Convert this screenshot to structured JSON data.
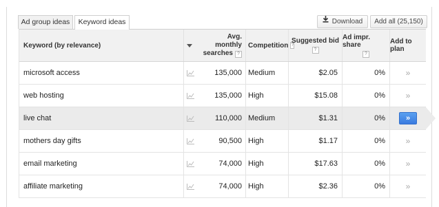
{
  "tabs": [
    {
      "label": "Ad group ideas"
    },
    {
      "label": "Keyword ideas"
    }
  ],
  "toolbar": {
    "download_label": "Download",
    "add_all_label": "Add all (25,150)"
  },
  "table": {
    "headers": {
      "keyword": "Keyword (by relevance)",
      "avg_line1": "Avg.",
      "avg_line2": "monthly",
      "avg_line3": "searches",
      "competition": "Competition",
      "suggested_bid": "Suggested bid",
      "ad_impr_share": "Ad impr. share",
      "add_to_plan": "Add to plan"
    },
    "help_mark": "?",
    "add_arrows": "»",
    "rows": [
      {
        "keyword": "microsoft access",
        "searches": "135,000",
        "competition": "Medium",
        "bid": "$2.05",
        "share": "0%"
      },
      {
        "keyword": "web hosting",
        "searches": "135,000",
        "competition": "High",
        "bid": "$15.08",
        "share": "0%"
      },
      {
        "keyword": "live chat",
        "searches": "110,000",
        "competition": "Medium",
        "bid": "$1.31",
        "share": "0%"
      },
      {
        "keyword": "mothers day gifts",
        "searches": "90,500",
        "competition": "High",
        "bid": "$1.17",
        "share": "0%"
      },
      {
        "keyword": "email marketing",
        "searches": "74,000",
        "competition": "High",
        "bid": "$17.63",
        "share": "0%"
      },
      {
        "keyword": "affiliate marketing",
        "searches": "74,000",
        "competition": "High",
        "bid": "$2.36",
        "share": "0%"
      }
    ]
  },
  "colors": {
    "accent": "#3a7be0",
    "highlight_row": "#ebebeb"
  }
}
